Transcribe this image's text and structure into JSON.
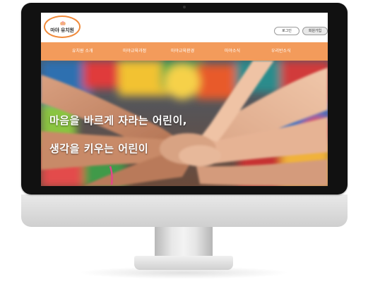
{
  "site": {
    "logo_text": "마야 유치원"
  },
  "header": {
    "login_label": "로그인",
    "join_label": "회원가입"
  },
  "nav": {
    "items": [
      {
        "label": "유치원 소개"
      },
      {
        "label": "마야교육과정"
      },
      {
        "label": "마야교육환경"
      },
      {
        "label": "마야소식"
      },
      {
        "label": "우리반소식"
      }
    ]
  },
  "hero": {
    "line1": "마음을 바르게 자라는 어린이,",
    "line2": "생각을 키우는 어린이"
  },
  "colors": {
    "accent": "#f39b5b",
    "logo_border": "#f08a3a",
    "bezel": "#111111"
  }
}
